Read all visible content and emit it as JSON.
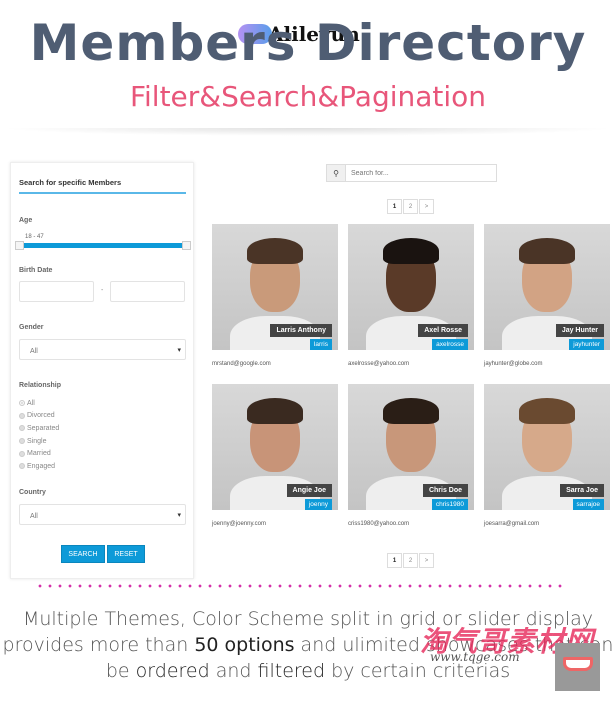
{
  "header": {
    "title": "Members Directory",
    "subtitle": "Filter&Search&Pagination",
    "logo_text": "Alileyun"
  },
  "filter": {
    "heading": "Search for specific Members",
    "age_label": "Age",
    "age_range": "18 - 47",
    "age_min": 18,
    "age_max": 47,
    "birth_label": "Birth Date",
    "birth_sep": "-",
    "gender_label": "Gender",
    "gender_value": "All",
    "relationship_label": "Relationship",
    "relationships": [
      "All",
      "Divorced",
      "Separated",
      "Single",
      "Married",
      "Engaged"
    ],
    "relationship_selected": "All",
    "country_label": "Country",
    "country_value": "All",
    "search_label": "SEARCH",
    "reset_label": "RESET"
  },
  "search": {
    "placeholder": "Search for...",
    "icon": "search-icon"
  },
  "pagination": {
    "pages": [
      "1",
      "2",
      ">"
    ],
    "current": "1"
  },
  "members": [
    {
      "name": "Larris Anthony",
      "username": "larris",
      "email": "mrstand@google.com"
    },
    {
      "name": "Axel Rosse",
      "username": "axelrosse",
      "email": "axelrosse@yahoo.com"
    },
    {
      "name": "Jay Hunter",
      "username": "jayhunter",
      "email": "jayhunter@globe.com"
    },
    {
      "name": "Angie Joe",
      "username": "joenny",
      "email": "joenny@joenny.com"
    },
    {
      "name": "Chris Doe",
      "username": "chris1980",
      "email": "criss1980@yahoo.com"
    },
    {
      "name": "Sarra Joe",
      "username": "sarrajoe",
      "email": "joesarra@gmail.com"
    }
  ],
  "footer": {
    "line1": "Multiple Themes, Color Scheme split in grid or slider display",
    "line2_a": "provides more than ",
    "line2_b": "50 options",
    "line2_c": " and ulimited showcases that can",
    "line3_a": "be ",
    "line3_b": "ordered",
    "line3_c": " and ",
    "line3_d": "filtered",
    "line3_e": " by certain criterias"
  },
  "watermark": {
    "text": "淘气哥素材网",
    "url": "www.tqge.com"
  },
  "colors": {
    "accent": "#0d9ad8",
    "title": "#4f5d73",
    "subtitle": "#e8567a",
    "dots": "#d42fa8"
  }
}
